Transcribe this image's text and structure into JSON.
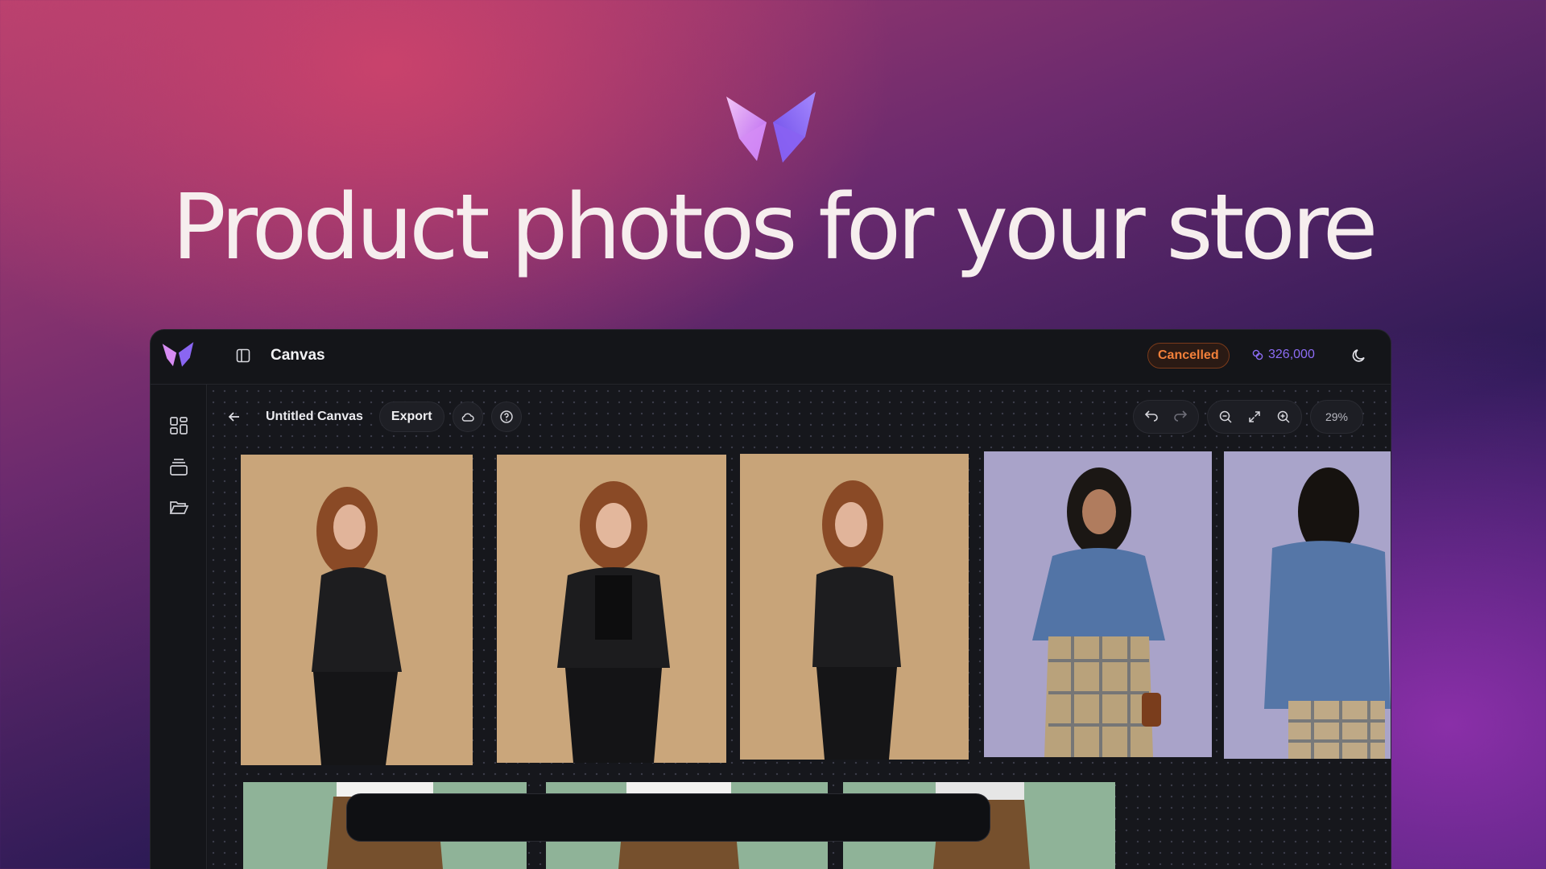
{
  "hero": {
    "logo_icon": "butterfly-logo-icon",
    "headline": "Product photos for your store"
  },
  "app": {
    "title": "Canvas",
    "status": "Cancelled",
    "credits": "326,000",
    "canvas_name": "Untitled Canvas",
    "export_label": "Export",
    "zoom": "29%"
  },
  "icons": {
    "sidebar_toggle": "sidebar-toggle-icon",
    "theme": "moon-icon",
    "credits": "coins-icon",
    "back": "arrow-left-icon",
    "cloud": "cloud-icon",
    "help": "help-circle-icon",
    "undo": "undo-icon",
    "redo": "redo-icon",
    "zoom_out": "zoom-out-icon",
    "fit": "expand-icon",
    "zoom_in": "zoom-in-icon",
    "sidebar_items": [
      "dashboard-grid-icon",
      "layers-icon",
      "folder-open-icon"
    ]
  },
  "colors": {
    "accent_purple": "#8c6cf4",
    "status_orange": "#f3803a",
    "app_bg": "#141519"
  }
}
